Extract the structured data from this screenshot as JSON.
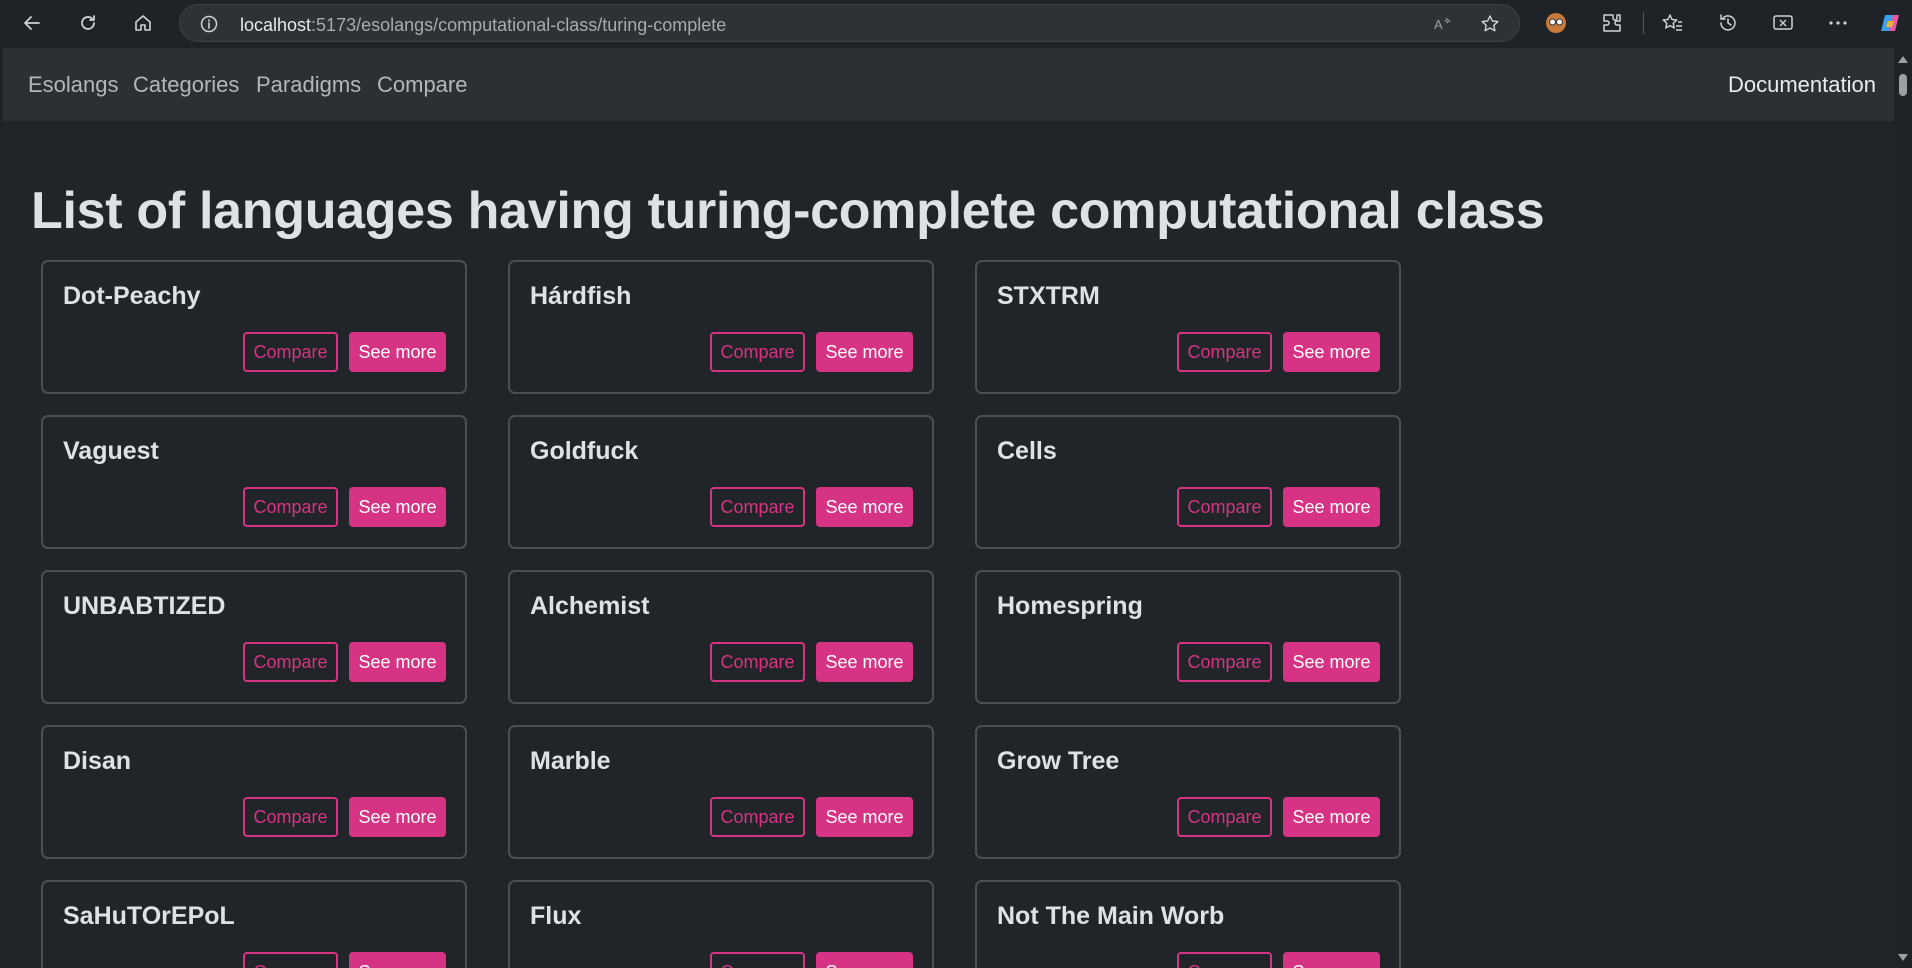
{
  "browser": {
    "url_host": "localhost",
    "url_path": ":5173/esolangs/computational-class/turing-complete"
  },
  "nav": {
    "links": [
      "Esolangs",
      "Categories",
      "Paradigms",
      "Compare"
    ],
    "documentation": "Documentation"
  },
  "page": {
    "title": "List of languages having turing-complete computational class"
  },
  "buttons": {
    "compare": "Compare",
    "see_more": "See more"
  },
  "languages": [
    "Dot-Peachy",
    "Hárdfish",
    "STXTRM",
    "Vaguest",
    "Goldfuck",
    "Cells",
    "UNBABTIZED",
    "Alchemist",
    "Homespring",
    "Disan",
    "Marble",
    "Grow Tree",
    "SaHuTOrEPoL",
    "Flux",
    "Not The Main Worb"
  ],
  "colors": {
    "accent": "#d63384",
    "background": "#212529",
    "navbar": "#2b3035"
  }
}
